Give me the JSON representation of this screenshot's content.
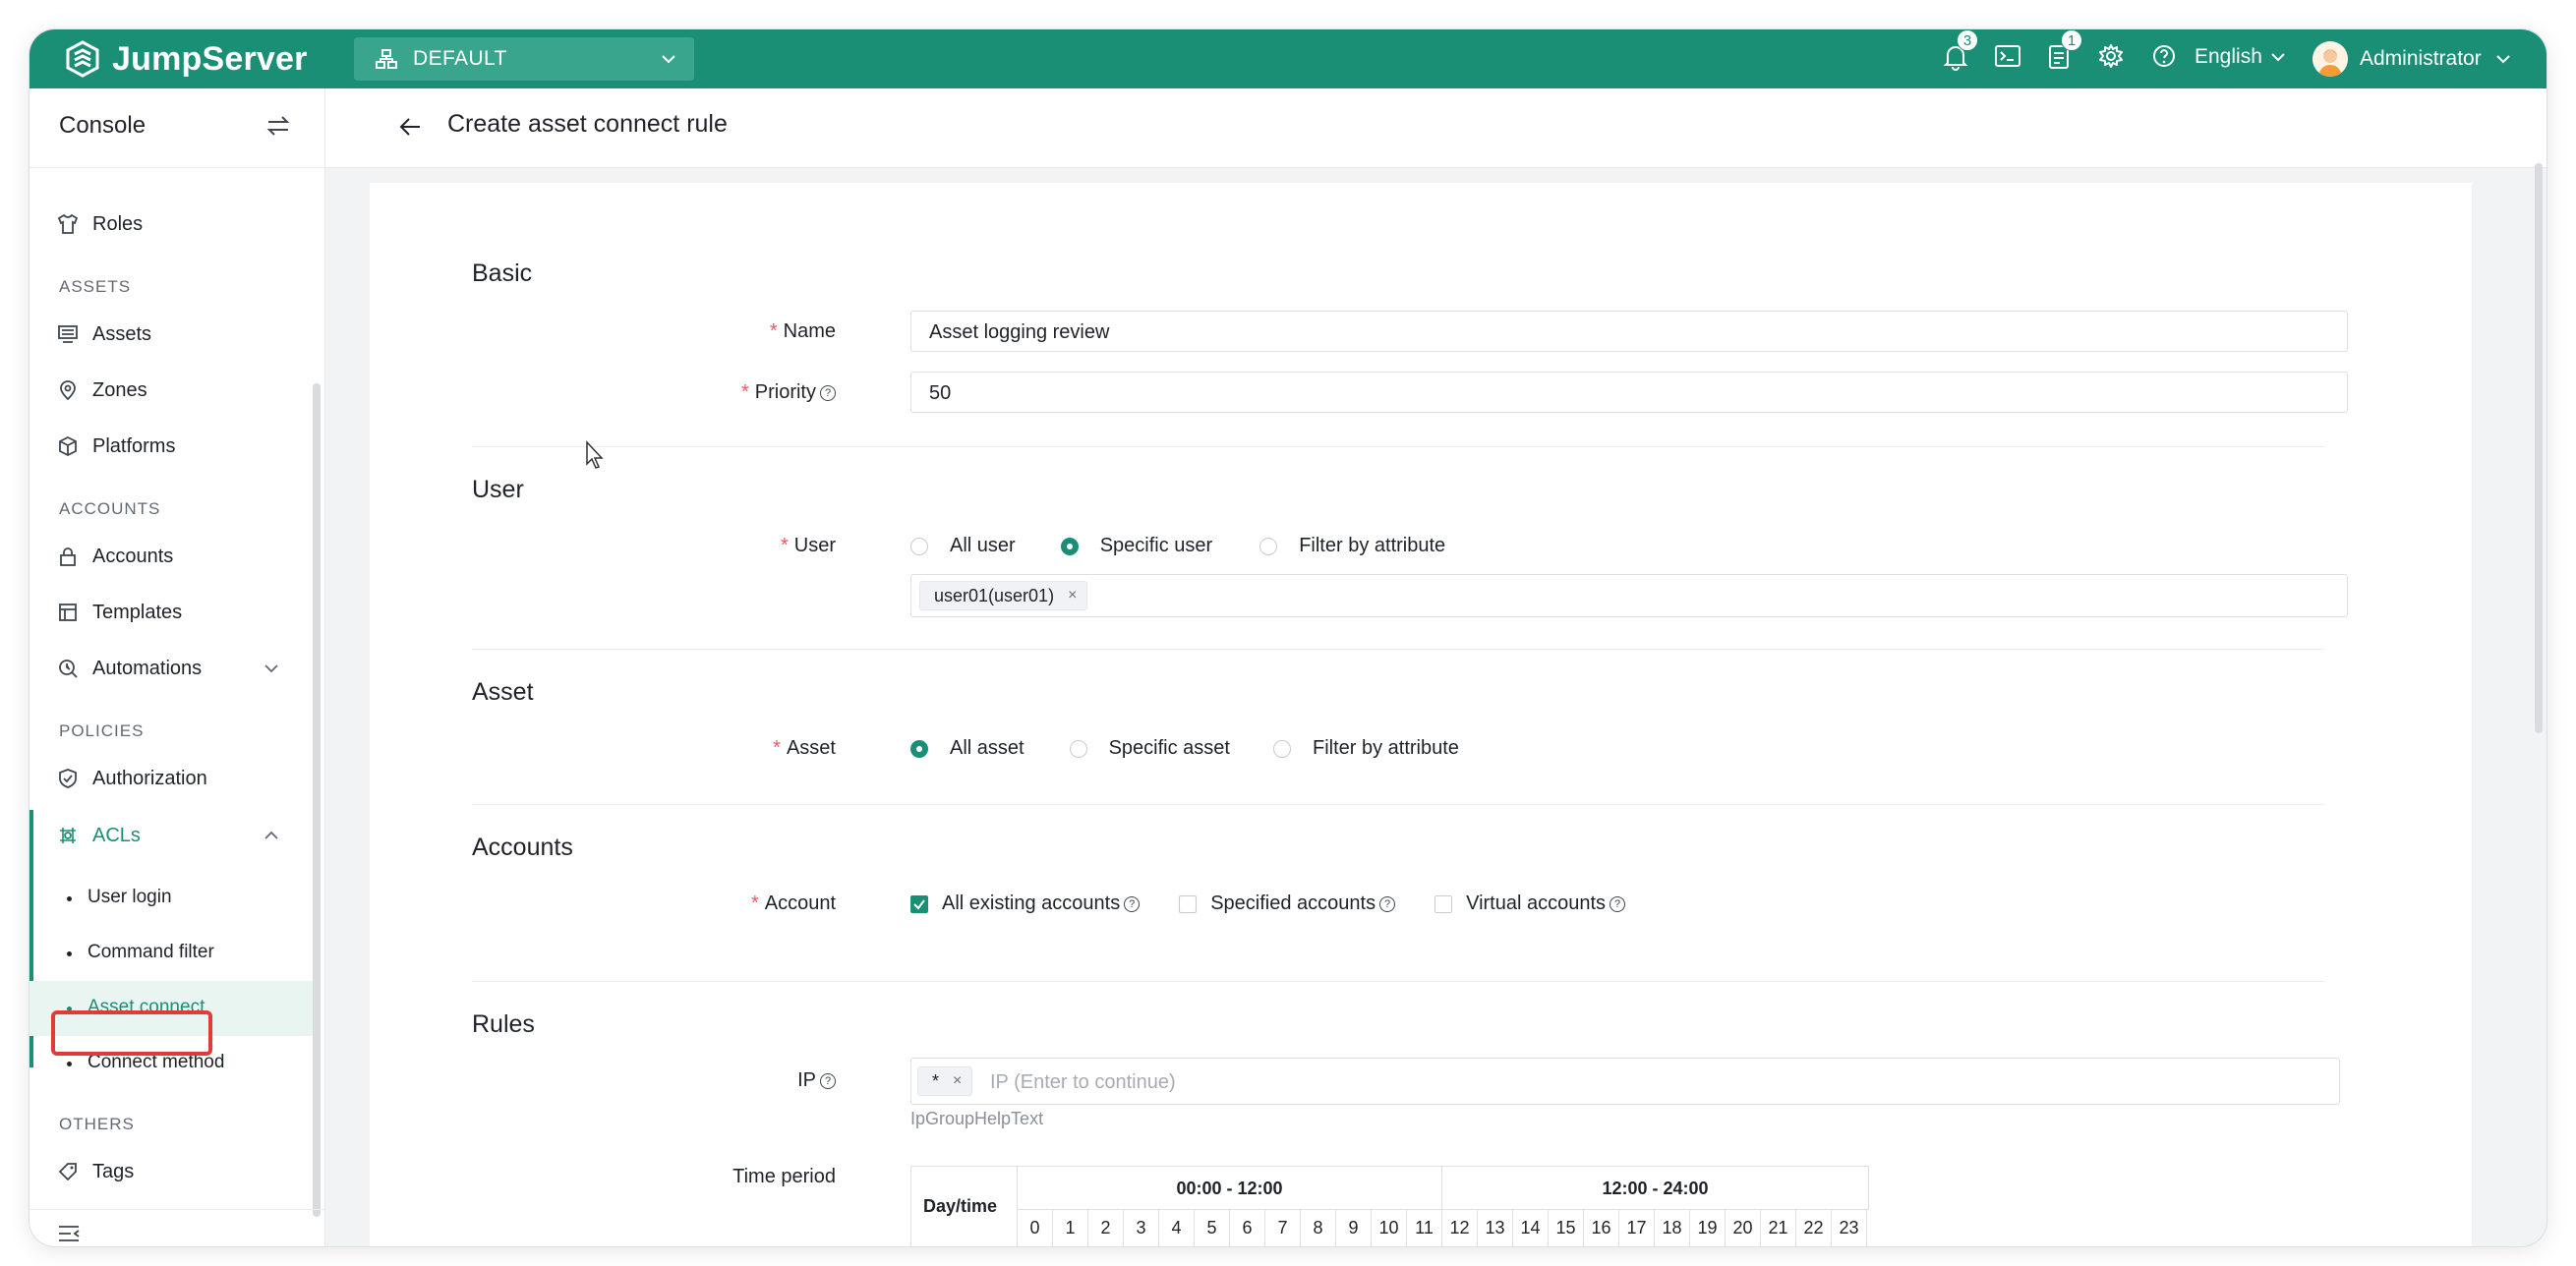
{
  "topbar": {
    "brand": "JumpServer",
    "org": "DEFAULT",
    "notifications_badge": "3",
    "tickets_badge": "1",
    "language": "English",
    "user": "Administrator"
  },
  "sidebar": {
    "title": "Console",
    "items": {
      "roles": "Roles",
      "assets_section": "ASSETS",
      "assets": "Assets",
      "zones": "Zones",
      "platforms": "Platforms",
      "accounts_section": "ACCOUNTS",
      "accounts": "Accounts",
      "templates": "Templates",
      "automations": "Automations",
      "policies_section": "POLICIES",
      "authorization": "Authorization",
      "acls": "ACLs",
      "user_login": "User login",
      "command_filter": "Command filter",
      "asset_connect": "Asset connect",
      "connect_method": "Connect method",
      "others_section": "OTHERS",
      "tags": "Tags"
    }
  },
  "page": {
    "title": "Create asset connect rule"
  },
  "form": {
    "basic": {
      "section": "Basic",
      "name_label": "Name",
      "name_value": "Asset logging review",
      "priority_label": "Priority",
      "priority_value": "50"
    },
    "user": {
      "section": "User",
      "label": "User",
      "options": [
        "All user",
        "Specific user",
        "Filter by attribute"
      ],
      "selected": "Specific user",
      "selected_users": [
        "user01(user01)"
      ]
    },
    "asset": {
      "section": "Asset",
      "label": "Asset",
      "options": [
        "All asset",
        "Specific asset",
        "Filter by attribute"
      ],
      "selected": "All asset"
    },
    "accounts": {
      "section": "Accounts",
      "label": "Account",
      "options": [
        "All existing accounts",
        "Specified accounts",
        "Virtual accounts"
      ],
      "checked": [
        "All existing accounts"
      ]
    },
    "rules": {
      "section": "Rules",
      "ip_label": "IP",
      "ip_tags": [
        "*"
      ],
      "ip_placeholder": "IP (Enter to continue)",
      "ip_help": "IpGroupHelpText",
      "time_label": "Time period",
      "day_header": "Day/time",
      "am_header": "00:00 - 12:00",
      "pm_header": "12:00 - 24:00",
      "hours": [
        "0",
        "1",
        "2",
        "3",
        "4",
        "5",
        "6",
        "7",
        "8",
        "9",
        "10",
        "11",
        "12",
        "13",
        "14",
        "15",
        "16",
        "17",
        "18",
        "19",
        "20",
        "21",
        "22",
        "23"
      ]
    }
  },
  "colors": {
    "brand": "#1a8f76",
    "required": "#f0565f",
    "highlight": "#e03a3a"
  }
}
